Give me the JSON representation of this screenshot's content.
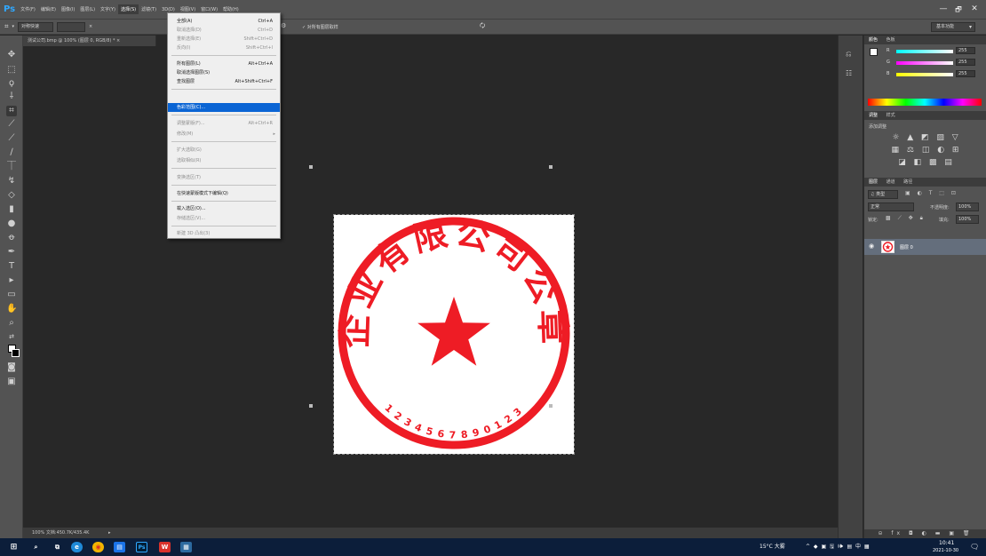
{
  "app": {
    "logo": "Ps"
  },
  "menubar": {
    "items": [
      "文件(F)",
      "编辑(E)",
      "图像(I)",
      "图层(L)",
      "文字(Y)",
      "选择(S)",
      "滤镜(T)",
      "3D(D)",
      "视图(V)",
      "窗口(W)",
      "帮助(H)"
    ],
    "active_index": 5
  },
  "window_controls": {
    "minimize": "—",
    "maximize": "🗗",
    "close": "✕"
  },
  "options_bar": {
    "mode": "对称快速",
    "width_value": "",
    "sample_all_layers": "✓ 对所有图层取样",
    "refine": "🗘",
    "workspace": "基本功能"
  },
  "document": {
    "tab_title": "测试公司.bmp @ 100% (图层 0, RGB/8) * ×",
    "status": "100%   文档:450.7K/435.4K"
  },
  "select_menu": {
    "items": [
      {
        "label": "全部(A)",
        "shortcut": "Ctrl+A",
        "disabled": false
      },
      {
        "label": "取消选择(D)",
        "shortcut": "Ctrl+D",
        "disabled": true
      },
      {
        "label": "重新选择(E)",
        "shortcut": "Shift+Ctrl+D",
        "disabled": true
      },
      {
        "label": "反向(I)",
        "shortcut": "Shift+Ctrl+I",
        "disabled": true
      },
      {
        "label": "所有图层(L)",
        "shortcut": "Alt+Ctrl+A",
        "disabled": false
      },
      {
        "label": "取消选择图层(S)",
        "shortcut": "",
        "disabled": false
      },
      {
        "label": "查找图层",
        "shortcut": "Alt+Shift+Ctrl+F",
        "disabled": false
      },
      {
        "label": "色彩范围(C)...",
        "shortcut": "",
        "disabled": false,
        "highlighted": true
      },
      {
        "label": "调整蒙版(F)...",
        "shortcut": "Alt+Ctrl+R",
        "disabled": true
      },
      {
        "label": "修改(M)",
        "shortcut": "",
        "disabled": true,
        "submenu": true
      },
      {
        "label": "扩大选取(G)",
        "shortcut": "",
        "disabled": true
      },
      {
        "label": "选取相似(R)",
        "shortcut": "",
        "disabled": true
      },
      {
        "label": "变换选区(T)",
        "shortcut": "",
        "disabled": true
      },
      {
        "label": "在快速蒙版模式下编辑(Q)",
        "shortcut": "",
        "disabled": false
      },
      {
        "label": "载入选区(O)...",
        "shortcut": "",
        "disabled": false
      },
      {
        "label": "存储选区(V)...",
        "shortcut": "",
        "disabled": true
      },
      {
        "label": "新建 3D 凸出(3)",
        "shortcut": "",
        "disabled": true
      }
    ]
  },
  "seal": {
    "text": "企业有限公司公章",
    "number": "1234567890123",
    "color": "#ee1c25"
  },
  "color_panel": {
    "tabs": [
      "颜色",
      "色板"
    ],
    "channels": [
      {
        "label": "R",
        "value": "255"
      },
      {
        "label": "G",
        "value": "255"
      },
      {
        "label": "B",
        "value": "255"
      }
    ]
  },
  "adjustments_panel": {
    "tabs": [
      "调整",
      "样式"
    ],
    "title": "添加调整"
  },
  "layers_panel": {
    "tabs": [
      "图层",
      "通道",
      "路径"
    ],
    "filter": "♫ 类型",
    "blend_mode": "正常",
    "opacity_label": "不透明度:",
    "opacity": "100%",
    "lock_label": "锁定:",
    "fill_label": "填充:",
    "fill": "100%",
    "layers": [
      {
        "name": "图层 0",
        "visible": true
      }
    ]
  },
  "taskbar": {
    "weather": "15°C 大雾",
    "tray_icons": "^ ◆ ▣ 🖫 🕪 ▤ 中 ▦",
    "time": "10:41",
    "date": "2021-10-30"
  }
}
